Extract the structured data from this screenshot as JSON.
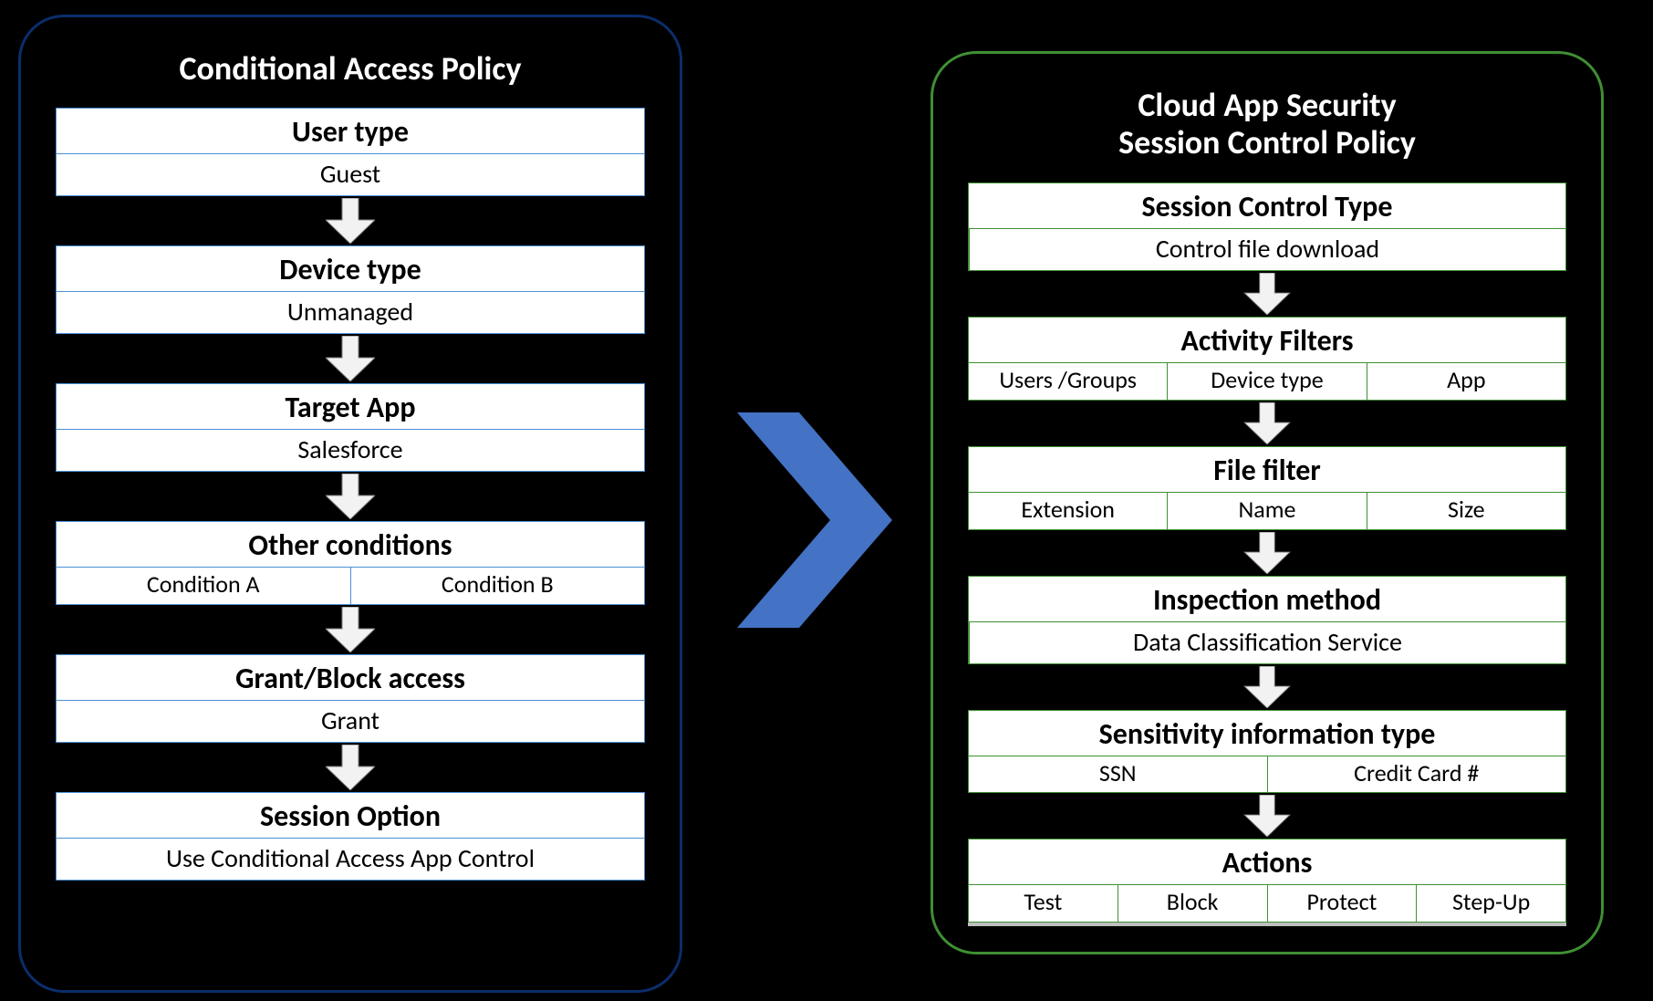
{
  "colors": {
    "left_border": "#0a2e6b",
    "right_border": "#3f8f33",
    "chevron_fill": "#4472c4",
    "down_arrow_fill": "#f2f2f2",
    "down_arrow_stroke": "#7f7f7f"
  },
  "left": {
    "title": "Conditional Access Policy",
    "steps": [
      {
        "title": "User type",
        "cells": [
          "Guest"
        ]
      },
      {
        "title": "Device type",
        "cells": [
          "Unmanaged"
        ]
      },
      {
        "title": "Target App",
        "cells": [
          "Salesforce"
        ]
      },
      {
        "title": "Other conditions",
        "cells": [
          "Condition A",
          "Condition B"
        ]
      },
      {
        "title": "Grant/Block access",
        "cells": [
          "Grant"
        ]
      },
      {
        "title": "Session Option",
        "cells": [
          "Use Conditional Access App Control"
        ]
      }
    ]
  },
  "right": {
    "title": "Cloud App Security\nSession Control Policy",
    "steps": [
      {
        "title": "Session Control Type",
        "cells": [
          "Control file download"
        ]
      },
      {
        "title": "Activity Filters",
        "cells": [
          "Users /Groups",
          "Device type",
          "App"
        ]
      },
      {
        "title": "File filter",
        "cells": [
          "Extension",
          "Name",
          "Size"
        ]
      },
      {
        "title": "Inspection method",
        "cells": [
          "Data Classification Service"
        ]
      },
      {
        "title": "Sensitivity information type",
        "cells": [
          "SSN",
          "Credit Card #"
        ]
      },
      {
        "title": "Actions",
        "cells": [
          "Test",
          "Block",
          "Protect",
          "Step-Up"
        ]
      }
    ]
  }
}
